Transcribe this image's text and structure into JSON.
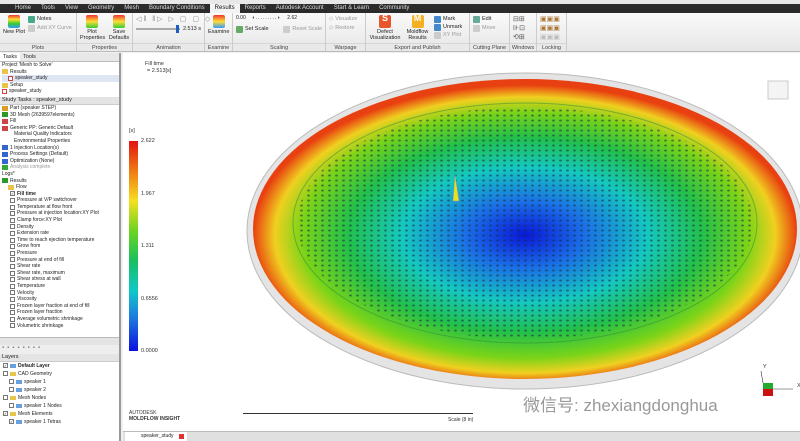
{
  "tabs": [
    "Home",
    "Tools",
    "View",
    "Geometry",
    "Mesh",
    "Boundary Conditions",
    "Results",
    "Reports",
    "Autodesk Account",
    "Start & Learn",
    "Community"
  ],
  "active_tab": "Results",
  "ribbon": {
    "plots": {
      "label": "Plots",
      "new_plot": "New Plot",
      "notes": "Notes",
      "add_xy": "Add XY Curve"
    },
    "properties": {
      "label": "Properties",
      "plot_props": "Plot Properties",
      "save_defaults": "Save Defaults"
    },
    "animation": {
      "label": "Animation",
      "time": "2.513 s",
      "progress": 0.958
    },
    "examine": {
      "label": "Examine",
      "btn": "Examine"
    },
    "scaling": {
      "label": "Scaling",
      "min": "0.00",
      "max": "2.62",
      "set_scale": "Set Scale",
      "reset_scale": "Reset Scale"
    },
    "warpage": {
      "label": "Warpage",
      "visualize": "Visualize",
      "restore": "Restore"
    },
    "export": {
      "label": "Export and Publish",
      "defect": "Defect Visualization",
      "moldflow": "Moldflow Results",
      "mark": "Mark",
      "unmark": "Unmark",
      "xy_plot": "XY Plot"
    },
    "cutting": {
      "label": "Cutting Plane",
      "edit": "Edit",
      "move": "Move"
    },
    "windows": {
      "label": "Windows"
    },
    "locking": {
      "label": "Locking"
    }
  },
  "left": {
    "tabs": [
      "Tasks",
      "Tools"
    ],
    "project": "Project 'Mesh to Solve'",
    "project_items": [
      "Results",
      "speaker_study",
      "Setup",
      "speaker_study"
    ],
    "study_header": "Study Tasks : speaker_study",
    "tasks": [
      "Part (speaker STEP)",
      "3D Mesh (2639597elements)",
      "Fill",
      "Generic PP: Generic Default",
      "Material Quality Indicators",
      "Environmental Properties",
      "1 Injection Location(s)",
      "Process Settings (Default)",
      "Optimization (None)",
      "Analysis complete",
      "Logs*",
      "Results",
      "Flow"
    ],
    "results": [
      {
        "label": "Fill time",
        "checked": true
      },
      {
        "label": "Pressure at V/P switchover",
        "checked": false
      },
      {
        "label": "Temperature at flow front",
        "checked": false
      },
      {
        "label": "Pressure at injection location:XY Plot",
        "checked": false
      },
      {
        "label": "Clamp force:XY Plot",
        "checked": false
      },
      {
        "label": "Density",
        "checked": false
      },
      {
        "label": "Extension rate",
        "checked": false
      },
      {
        "label": "Time to reach ejection temperature",
        "checked": false
      },
      {
        "label": "Grow from",
        "checked": false
      },
      {
        "label": "Pressure",
        "checked": false
      },
      {
        "label": "Pressure at end of fill",
        "checked": false
      },
      {
        "label": "Shear rate",
        "checked": false
      },
      {
        "label": "Shear rate, maximum",
        "checked": false
      },
      {
        "label": "Shear stress at wall",
        "checked": false
      },
      {
        "label": "Temperature",
        "checked": false
      },
      {
        "label": "Velocity",
        "checked": false
      },
      {
        "label": "Viscosity",
        "checked": false
      },
      {
        "label": "Frozen layer fraction at end of fill",
        "checked": false
      },
      {
        "label": "Frozen layer fraction",
        "checked": false
      },
      {
        "label": "Average volumetric shrinkage",
        "checked": false
      },
      {
        "label": "Volumetric shrinkage",
        "checked": false
      }
    ],
    "layers_header": "Layers",
    "layers": [
      {
        "label": "Default Layer",
        "checked": true,
        "indent": 0,
        "bold": true
      },
      {
        "label": "CAD Geometry",
        "checked": false,
        "indent": 0
      },
      {
        "label": "speaker 1",
        "checked": false,
        "indent": 1
      },
      {
        "label": "speaker 2",
        "checked": false,
        "indent": 1
      },
      {
        "label": "Mesh Nodes",
        "checked": false,
        "indent": 0
      },
      {
        "label": "speaker 1 Nodes",
        "checked": false,
        "indent": 1
      },
      {
        "label": "Mesh Elements",
        "checked": true,
        "indent": 0
      },
      {
        "label": "speaker 1 Tetras",
        "checked": true,
        "indent": 1
      }
    ]
  },
  "view": {
    "result_title": "Fill time",
    "result_value": "= 2.513[s]",
    "unit": "[s]",
    "legend": [
      "2.622",
      "1.967",
      "1.311",
      "0.6556",
      "0.0000"
    ],
    "brand1": "AUTODESK",
    "brand2": "MOLDFLOW INSIGHT",
    "scale": "Scale (8 in)",
    "watermark": "微信号: zhexiangdonghua",
    "axis_x": "X",
    "axis_y": "Y"
  },
  "doc_tab": "speaker_study"
}
